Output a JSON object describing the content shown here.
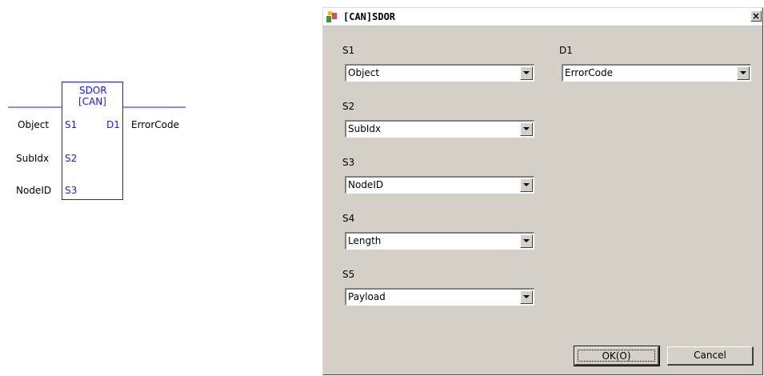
{
  "ladder": {
    "block_name": "SDOR",
    "block_sub": "[CAN]",
    "inputs": [
      {
        "port": "S1",
        "operand": "Object"
      },
      {
        "port": "S2",
        "operand": "SubIdx"
      },
      {
        "port": "S3",
        "operand": "NodeID"
      }
    ],
    "output": {
      "port": "D1",
      "operand": "ErrorCode"
    }
  },
  "dialog": {
    "title": "[CAN]SDOR",
    "close_label": "×",
    "fields": [
      {
        "label": "S1",
        "value": "Object"
      },
      {
        "label": "S2",
        "value": "SubIdx"
      },
      {
        "label": "S3",
        "value": "NodeID"
      },
      {
        "label": "S4",
        "value": "Length"
      },
      {
        "label": "S5",
        "value": "Payload"
      }
    ],
    "d1": {
      "label": "D1",
      "value": "ErrorCode"
    },
    "ok_label": "OK(O)",
    "cancel_label": "Cancel"
  }
}
